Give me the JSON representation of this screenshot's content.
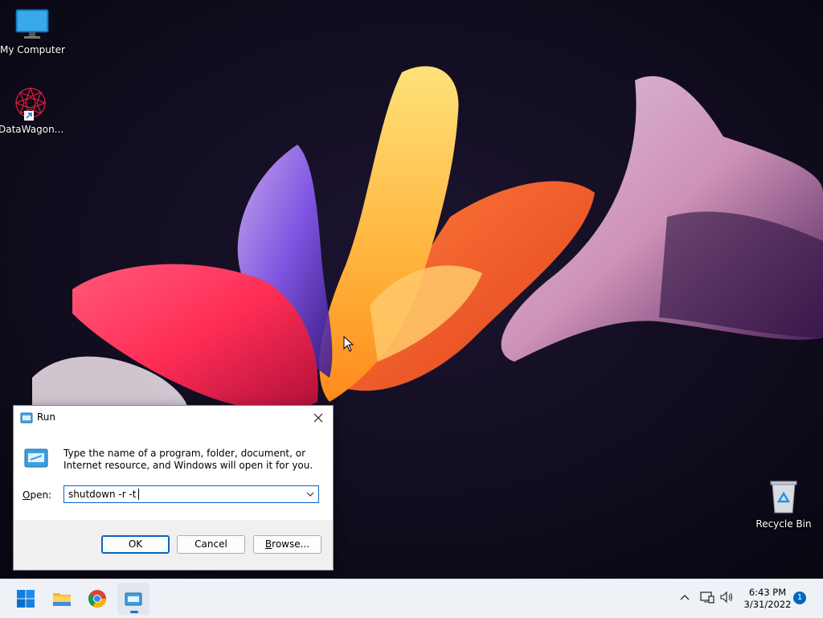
{
  "desktop": {
    "icons": [
      {
        "label": "My Computer"
      },
      {
        "label": "DataWagon..."
      },
      {
        "label": "Recycle Bin"
      }
    ]
  },
  "run_dialog": {
    "title": "Run",
    "description": "Type the name of a program, folder, document, or Internet resource, and Windows will open it for you.",
    "open_label_prefix": "O",
    "open_label_rest": "pen:",
    "open_value": "shutdown -r -t",
    "buttons": {
      "ok": "OK",
      "cancel": "Cancel",
      "browse_prefix": "B",
      "browse_rest": "rowse..."
    }
  },
  "taskbar": {
    "pinned": [
      {
        "icon": "windows-start-icon"
      },
      {
        "icon": "file-explorer-icon"
      },
      {
        "icon": "chrome-icon"
      },
      {
        "icon": "run-app-icon"
      }
    ],
    "clock": {
      "time": "6:43 PM",
      "date": "3/31/2022"
    },
    "notification_count": "1"
  },
  "colors": {
    "accent": "#0067c0",
    "dialog_border": "#0a62c8",
    "taskbar": "#eef1f6"
  }
}
